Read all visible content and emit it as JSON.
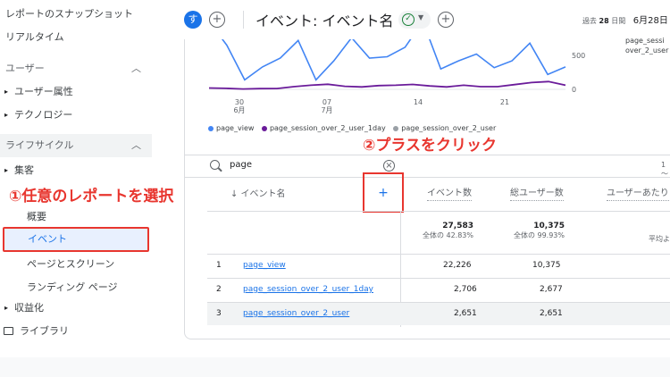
{
  "sidebar": {
    "snapshot": "レポートのスナップショット",
    "realtime": "リアルタイム",
    "users_section": "ユーザー",
    "user_attributes": "ユーザー属性",
    "technology": "テクノロジー",
    "lifecycle_section": "ライフサイクル",
    "acquisition": "集客",
    "overview": "概要",
    "events": "イベント",
    "pages_screens": "ページとスクリーン",
    "landing_page": "ランディング ページ",
    "monetization": "収益化",
    "library": "ライブラリ",
    "chevron": "^"
  },
  "topbar": {
    "avatar": "す",
    "title": "イベント: イベント名",
    "date_prefix": "過去",
    "date_days": "28",
    "date_unit": "日間",
    "date_start": "6月28日"
  },
  "chart_data": {
    "type": "line",
    "x_ticks": [
      "30\n6月",
      "07\n7月",
      "14",
      "21"
    ],
    "y_ticks": [
      "500",
      "0"
    ],
    "series": [
      {
        "name": "page_view",
        "color": "#4285f4",
        "values": [
          1000,
          650,
          140,
          330,
          460,
          720,
          140,
          420,
          760,
          460,
          480,
          620,
          1000,
          300,
          420,
          520,
          320,
          420,
          680,
          220,
          330
        ]
      },
      {
        "name": "page_session_over_2_user_1day",
        "color": "#6a1b9a",
        "values": [
          20,
          15,
          5,
          10,
          12,
          40,
          60,
          75,
          45,
          35,
          55,
          60,
          72,
          50,
          35,
          60,
          40,
          40,
          70,
          100,
          115,
          60
        ]
      },
      {
        "name": "page_session_over_2_user",
        "color": "#9aa0a6",
        "values": []
      }
    ],
    "right_legend": [
      "page_sessi",
      "over_2_user"
    ]
  },
  "annotations": {
    "step1": "①任意のレポートを選択",
    "step2": "②プラスをクリック"
  },
  "search": {
    "value": "page",
    "pager": "1 〜"
  },
  "table": {
    "col_event": "↓ イベント名",
    "col_plus": "+",
    "col_event_count": "イベント数",
    "col_total_users": "総ユーザー数",
    "col_per_user": "ユーザーあたり",
    "totals": {
      "event_count": "27,583",
      "event_count_pct": "全体の 42.83%",
      "total_users": "10,375",
      "total_users_pct": "全体の 99.93%",
      "per_user_sub": "平均よ"
    },
    "rows": [
      {
        "idx": "1",
        "name": "page_view",
        "event_count": "22,226",
        "users": "10,375"
      },
      {
        "idx": "2",
        "name": "page_session_over_2_user_1day",
        "event_count": "2,706",
        "users": "2,677"
      },
      {
        "idx": "3",
        "name": "page_session_over_2_user",
        "event_count": "2,651",
        "users": "2,651"
      }
    ]
  },
  "colors": {
    "accent": "#1a73e8",
    "annotation": "#e8362f"
  }
}
